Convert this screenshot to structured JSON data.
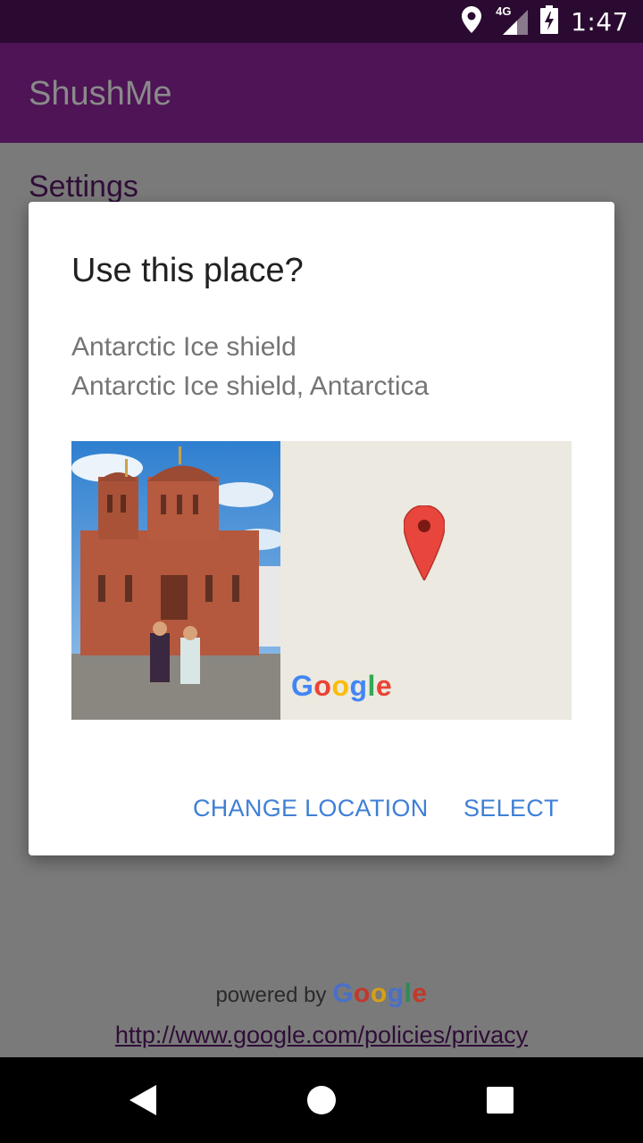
{
  "status_bar": {
    "time": "1:47",
    "network_label": "4G",
    "icons": [
      "location-icon",
      "signal-icon",
      "battery-charging-icon"
    ]
  },
  "app_bar": {
    "title": "ShushMe"
  },
  "main": {
    "section_label": "Settings",
    "powered_by_prefix": "powered by",
    "powered_by_brand": "Google",
    "privacy_link": "http://www.google.com/policies/privacy"
  },
  "dialog": {
    "title": "Use this place?",
    "place_name": "Antarctic Ice shield",
    "place_address": "Antarctic Ice shield, Antarctica",
    "map_logo": "Google",
    "buttons": {
      "change_location": "CHANGE LOCATION",
      "select": "SELECT"
    }
  },
  "nav_bar": {
    "icons": [
      "back-icon",
      "home-icon",
      "recents-icon"
    ]
  },
  "colors": {
    "status_bar": "#2b0a31",
    "app_bar": "#4e1456",
    "scrim": "#7a7a7a",
    "accent_button": "#3f7fd6",
    "map_bg": "#ebe9e0",
    "pin": "#e8453c"
  }
}
